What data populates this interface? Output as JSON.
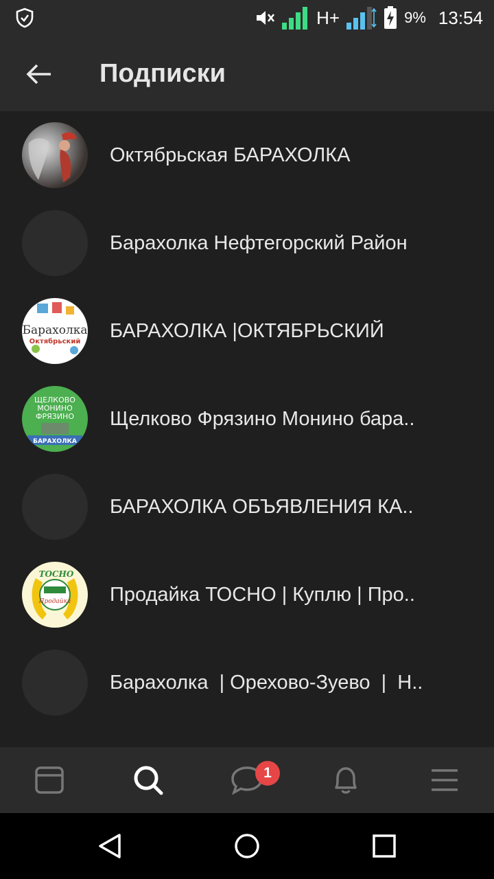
{
  "status_bar": {
    "battery_percent": "9%",
    "time": "13:54",
    "network_type": "H+",
    "icons": [
      "shield-icon",
      "mute-icon",
      "signal-icon",
      "battery-charging-icon"
    ]
  },
  "header": {
    "title": "Подписки",
    "back_icon": "arrow-left-icon"
  },
  "subscriptions": [
    {
      "label": "Октябрьская БАРАХОЛКА",
      "avatar": "photo"
    },
    {
      "label": "Барахолка Нефтегорский Район",
      "avatar": "empty"
    },
    {
      "label": "БАРАХОЛКА |ОКТЯБРЬСКИЙ",
      "avatar": "logo",
      "avatar_lines": [
        "Барахолка",
        "Октябрьский"
      ]
    },
    {
      "label": "Щелково Фрязино Монино бара..",
      "avatar": "logo",
      "avatar_lines": [
        "ЩЕЛКОВО",
        "МОНИНО",
        "ФРЯЗИНО",
        "БАРАХОЛКА"
      ]
    },
    {
      "label": "БАРАХОЛКА ОБЪЯВЛЕНИЯ КА..",
      "avatar": "empty"
    },
    {
      "label": "Продайка ТОСНО | Куплю | Про..",
      "avatar": "logo",
      "avatar_lines": [
        "ТОСНО",
        "Продайка"
      ]
    },
    {
      "label": "Барахолка  | Орехово-Зуево  |  Н..",
      "avatar": "empty"
    }
  ],
  "bottom_nav": {
    "items": [
      "feed-icon",
      "search-icon",
      "messages-icon",
      "bell-icon",
      "menu-icon"
    ],
    "active": "search-icon",
    "messages_badge": "1"
  },
  "system_nav": [
    "back-triangle-icon",
    "home-circle-icon",
    "recents-square-icon"
  ],
  "colors": {
    "background": "#1f1f1f",
    "bar": "#2b2b2b",
    "badge": "#e64646",
    "signal_green": "#3ddc84",
    "signal_blue": "#5bc2f0"
  }
}
